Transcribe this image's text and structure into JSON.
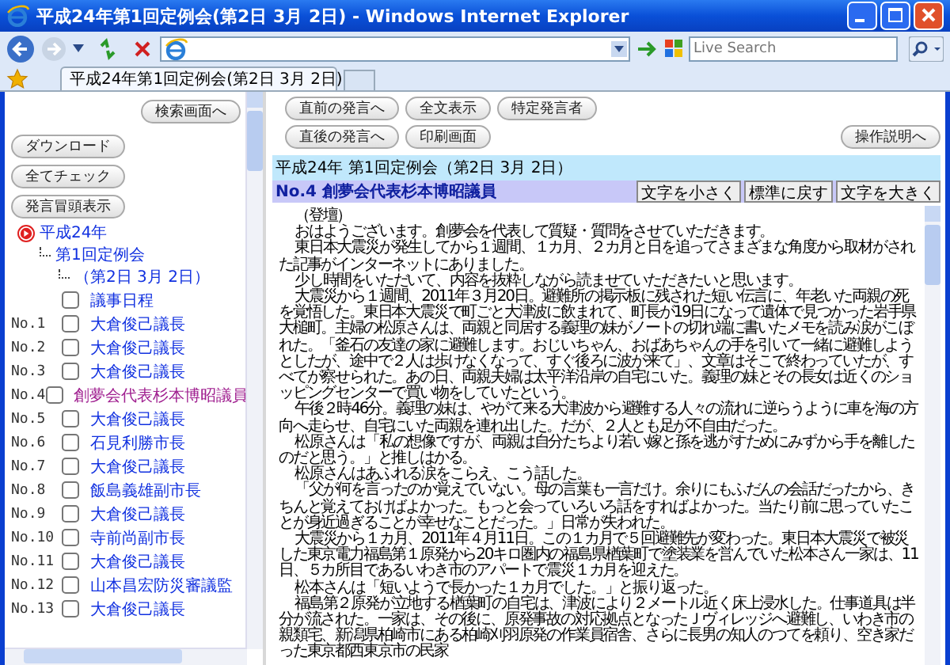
{
  "window": {
    "title": "平成24年第1回定例会(第2日 3月 2日) - Windows Internet Explorer"
  },
  "toolbar": {
    "search_placeholder": "Live Search"
  },
  "tabs": [
    {
      "label": "平成24年第1回定例会(第2日 3月 2日)",
      "selected": true
    }
  ],
  "left_frame": {
    "search_button": "検索画面へ",
    "buttons": [
      "ダウンロード",
      "全てチェック",
      "発言冒頭表示"
    ],
    "tree": {
      "label": "平成24年",
      "children": [
        {
          "label": "第1回定例会",
          "children": [
            {
              "label": "（第2日 3月 2日）"
            }
          ]
        }
      ]
    },
    "items": [
      {
        "label": "議事日程",
        "checked": false,
        "visited": false
      },
      {
        "number": "No.1",
        "label": "大倉俊己議長",
        "checked": false,
        "visited": false
      },
      {
        "number": "No.2",
        "label": "大倉俊己議長",
        "checked": false,
        "visited": false
      },
      {
        "number": "No.3",
        "label": "大倉俊己議長",
        "checked": false,
        "visited": false
      },
      {
        "number": "No.4",
        "label": "創夢会代表杉本博昭議員",
        "checked": false,
        "visited": true
      },
      {
        "number": "No.5",
        "label": "大倉俊己議長",
        "checked": false,
        "visited": false
      },
      {
        "number": "No.6",
        "label": "石見利勝市長",
        "checked": false,
        "visited": false
      },
      {
        "number": "No.7",
        "label": "大倉俊己議長",
        "checked": false,
        "visited": false
      },
      {
        "number": "No.8",
        "label": "飯島義雄副市長",
        "checked": false,
        "visited": false
      },
      {
        "number": "No.9",
        "label": "大倉俊己議長",
        "checked": false,
        "visited": false
      },
      {
        "number": "No.10",
        "label": "寺前尚副市長",
        "checked": false,
        "visited": false
      },
      {
        "number": "No.11",
        "label": "大倉俊己議長",
        "checked": false,
        "visited": false
      },
      {
        "number": "No.12",
        "label": "山本昌宏防災審議監",
        "checked": false,
        "visited": false
      },
      {
        "number": "No.13",
        "label": "大倉俊己議長",
        "checked": false,
        "visited": false
      }
    ]
  },
  "right_frame": {
    "nav_row_1": [
      "直前の発言へ",
      "全文表示",
      "特定発言者"
    ],
    "nav_row_2": [
      "直後の発言へ",
      "印刷画面"
    ],
    "help_button": "操作説明へ",
    "session_title": "平成24年 第1回定例会（第2日 3月 2日）",
    "speaker": "No.4 創夢会代表杉本博昭議員",
    "font_buttons": [
      "文字を小さく",
      "標準に戻す",
      "文字を大きく"
    ],
    "paragraphs": [
      "（登壇）",
      "おはようございます。創夢会を代表して質疑・質問をさせていただきます。",
      "東日本大震災が発生してから１週間、１カ月、２カ月と日を追ってさまざまな角度から取材がされた記事がインターネットにありました。",
      "少し時間をいただいて、内容を抜粋しながら読ませていただきたいと思います。",
      "大震災から１週間、2011年３月20日。避難所の掲示板に残された短い伝言に、年老いた両親の死を覚悟した。東日本大震災で町ごと大津波に飲まれて、町長が19日になって遺体で見つかった岩手県大槌町。主婦の松原さんは、両親と同居する義理の妹がノートの切れ端に書いたメモを読み涙がこぼれた。「釜石の友達の家に避難します。おじいちゃん、おばあちゃんの手を引いて一緒に避難しようとしたが、途中で２人は歩けなくなって、すぐ後ろに波が来て」、文章はそこで終わっていたが、すべてが察せられた。あの日、両親夫婦は太平洋沿岸の自宅にいた。義理の妹とその長女は近くのショッピングセンターで買い物をしていたという。",
      "午後２時46分。義理の妹は、やがて来る大津波から避難する人々の流れに逆らうように車を海の方向へ走らせ、自宅にいた両親を連れ出した。だが、２人とも足が不自由だった。",
      "松原さんは「私の想像ですが、両親は自分たちより若い嫁と孫を逃がすためにみずから手を離したのだと思う。」と推しはかる。",
      "松原さんはあふれる涙をこらえ、こう話した。",
      "「父が何を言ったのか覚えていない。母の言葉も一言だけ。余りにもふだんの会話だったから、きちんと覚えておけばよかった。もっと会っていろいろ話をすればよかった。当たり前に思っていたことが身近過ぎることが幸せなことだった。」日常が失われた。",
      "大震災から１カ月、2011年４月11日。この１カ月で５回避難先が変わった。東日本大震災で被災した東京電力福島第１原発から20キロ圏内の福島県楢葉町で塗装業を営んでいた松本さん一家は、11日、５カ所目であるいわき市のアパートで震災１カ月を迎えた。",
      "松本さんは「短いようで長かった１カ月でした。」と振り返った。",
      "福島第２原発が立地する楢葉町の自宅は、津波により２メートル近く床上浸水した。仕事道具は半分が流された。一家は、その後に、原発事故の対応拠点となったＪヴィレッジへ避難し、いわき市の親類宅、新潟県柏崎市にある柏崎刈羽原発の作業員宿舎、さらに長男の知人のつてを頼り、空き家だった東京都西東京市の民家"
    ]
  }
}
